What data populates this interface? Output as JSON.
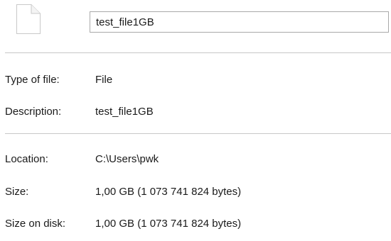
{
  "header": {
    "file_name": "test_file1GB",
    "icon": "blank-document-icon"
  },
  "general": {
    "type_label": "Type of file:",
    "type_value": "File",
    "description_label": "Description:",
    "description_value": "test_file1GB"
  },
  "details": {
    "location_label": "Location:",
    "location_value": "C:\\Users\\pwk",
    "size_label": "Size:",
    "size_value": "1,00 GB (1 073 741 824 bytes)",
    "size_on_disk_label": "Size on disk:",
    "size_on_disk_value": "1,00 GB (1 073 741 824 bytes)"
  }
}
